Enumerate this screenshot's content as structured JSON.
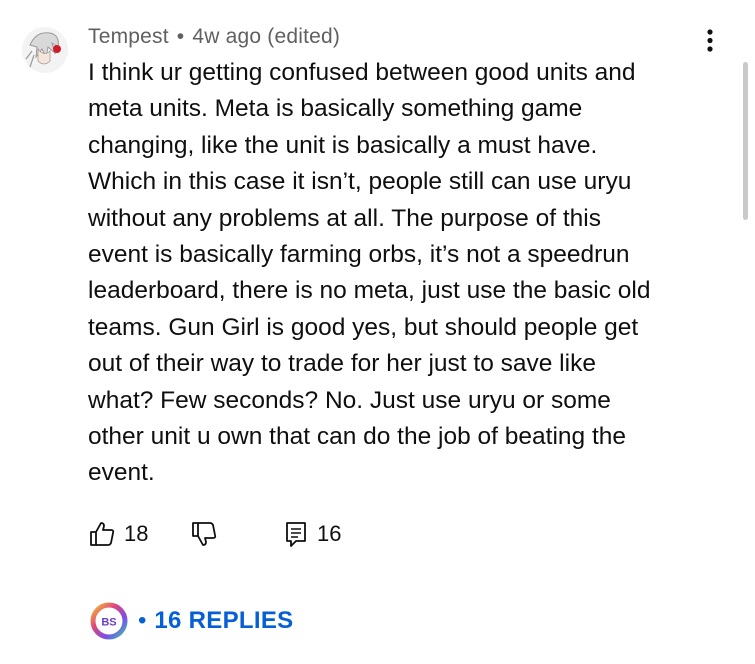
{
  "comment": {
    "author": "Tempest",
    "separator": "•",
    "time": "4w ago",
    "edited": "(edited)",
    "text": "I think ur getting confused between good units and\nmeta units. Meta is basically something game\nchanging, like the unit is basically a must have.\nWhich in this case it isn’t, people still can use uryu\nwithout any problems at all. The purpose of this\nevent is basically farming orbs, it’s not a speedrun\nleaderboard, there is no meta, just use the basic old\nteams. Gun Girl is good yes, but should people get\nout of their way to trade for her just to save like\nwhat? Few seconds? No. Just use uryu or some\nother unit u own that can do the job of beating the\nevent."
  },
  "actions": {
    "like_count": "18",
    "reply_count": "16"
  },
  "replies": {
    "separator": "•",
    "label": "16 REPLIES",
    "avatar_initials": "BS"
  },
  "icons": {
    "avatar": "anime-character-avatar",
    "menu": "more-vert-icon",
    "like": "thumbs-up-icon",
    "dislike": "thumbs-down-icon",
    "reply": "comment-icon"
  },
  "colors": {
    "text": "#0f0f0f",
    "secondary_text": "#606060",
    "link_blue": "#065fd4"
  }
}
